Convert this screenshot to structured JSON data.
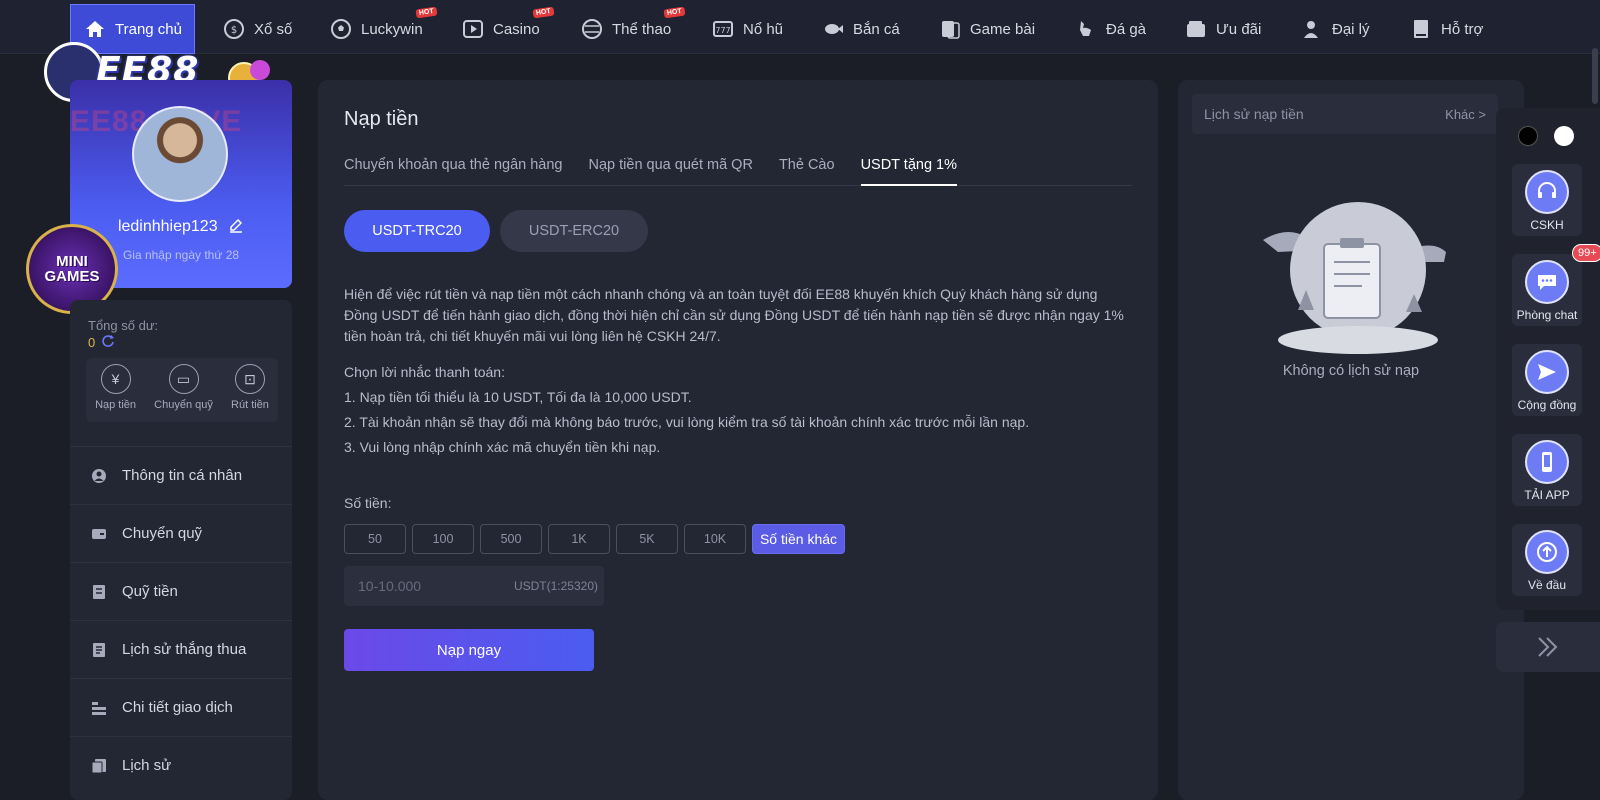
{
  "nav": {
    "items": [
      {
        "label": "Trang chủ",
        "icon": "home-icon",
        "active": true
      },
      {
        "label": "Xổ số",
        "icon": "lottery-icon"
      },
      {
        "label": "Luckywin",
        "icon": "soccer-icon",
        "hot": "HOT"
      },
      {
        "label": "Casino",
        "icon": "play-icon",
        "hot": "HOT"
      },
      {
        "label": "Thể thao",
        "icon": "ball-icon",
        "hot": "HOT"
      },
      {
        "label": "Nổ hũ",
        "icon": "slot-icon"
      },
      {
        "label": "Bắn cá",
        "icon": "fish-icon"
      },
      {
        "label": "Game bài",
        "icon": "cards-icon"
      },
      {
        "label": "Đá gà",
        "icon": "rooster-icon"
      },
      {
        "label": "Ưu đãi",
        "icon": "wallet-icon"
      },
      {
        "label": "Đại lý",
        "icon": "agent-icon"
      },
      {
        "label": "Hỗ trợ",
        "icon": "book-icon"
      }
    ]
  },
  "logo": {
    "text": "EE88"
  },
  "profile": {
    "watermark": "EE88.LOVE",
    "username": "ledinhhiep123",
    "joined": "Gia nhập ngày thứ 28"
  },
  "minigames": {
    "line1": "MINI",
    "line2": "GAMES"
  },
  "sidebar": {
    "balance_label": "Tổng số dư:",
    "balance_value": "0",
    "quick": [
      {
        "label": "Nạp tiền",
        "icon": "deposit-icon"
      },
      {
        "label": "Chuyển quỹ",
        "icon": "transfer-icon"
      },
      {
        "label": "Rút tiền",
        "icon": "withdraw-icon"
      }
    ],
    "menu": [
      {
        "label": "Thông tin cá nhân",
        "icon": "user-icon"
      },
      {
        "label": "Chuyển quỹ",
        "icon": "wallet-icon"
      },
      {
        "label": "Quỹ tiền",
        "icon": "fund-icon"
      },
      {
        "label": "Lịch sử thắng thua",
        "icon": "history-icon"
      },
      {
        "label": "Chi tiết giao dịch",
        "icon": "ledger-icon"
      },
      {
        "label": "Lịch sử",
        "icon": "records-icon"
      }
    ]
  },
  "main": {
    "title": "Nạp tiền",
    "tabs": [
      {
        "label": "Chuyển khoản qua thẻ ngân hàng"
      },
      {
        "label": "Nạp tiền qua quét mã QR"
      },
      {
        "label": "Thẻ Cào"
      },
      {
        "label": "USDT tặng 1%",
        "active": true
      }
    ],
    "networks": [
      {
        "label": "USDT-TRC20",
        "active": true
      },
      {
        "label": "USDT-ERC20"
      }
    ],
    "description": "Hiện để việc rút tiền và nạp tiền một cách nhanh chóng và an toàn tuyệt đối EE88 khuyến khích Quý khách hàng sử dụng Đồng USDT để tiến hành giao dịch, đồng thời hiện chỉ cần sử dụng Đồng USDT để tiến hành nạp tiền sẽ được nhận ngay 1% tiền hoàn trả, chi tiết khuyến mãi vui lòng liên hệ CSKH 24/7.",
    "reminder_title": "Chọn lời nhắc thanh toán:",
    "reminders": [
      "1. Nạp tiền tối thiểu là 10 USDT, Tối đa là 10,000 USDT.",
      "2. Tài khoản nhận sẽ thay đổi mà không báo trước, vui lòng kiểm tra số tài khoản chính xác trước mỗi lần nạp.",
      "3. Vui lòng nhập chính xác mã chuyển tiền khi nạp."
    ],
    "amount_label": "Số tiền:",
    "amount_chips": [
      "50",
      "100",
      "500",
      "1K",
      "5K",
      "10K"
    ],
    "amount_custom": "Số tiền khác",
    "amount_placeholder": "10-10.000",
    "amount_unit": "USDT(1:25320)",
    "submit_label": "Nạp ngay"
  },
  "history": {
    "title": "Lịch sử nạp tiền",
    "more": "Khác >",
    "empty": "Không có lịch sử nạp"
  },
  "dock": {
    "dot_colors": [
      "#000000",
      "#ffffff"
    ],
    "buttons": [
      {
        "label": "CSKH",
        "icon": "headset-icon"
      },
      {
        "label": "Phòng chat",
        "icon": "chat-icon",
        "badge": "99+"
      },
      {
        "label": "Cộng đồng",
        "icon": "send-icon"
      },
      {
        "label": "TẢI APP",
        "icon": "phone-icon"
      },
      {
        "label": "Về đầu",
        "icon": "arrow-up-icon"
      }
    ]
  },
  "colors": {
    "accent": "#4b5cf0",
    "accent_purple": "#6b49e8",
    "hot": "#e23a3a",
    "background": "#1b1e27",
    "panel": "#232734"
  }
}
